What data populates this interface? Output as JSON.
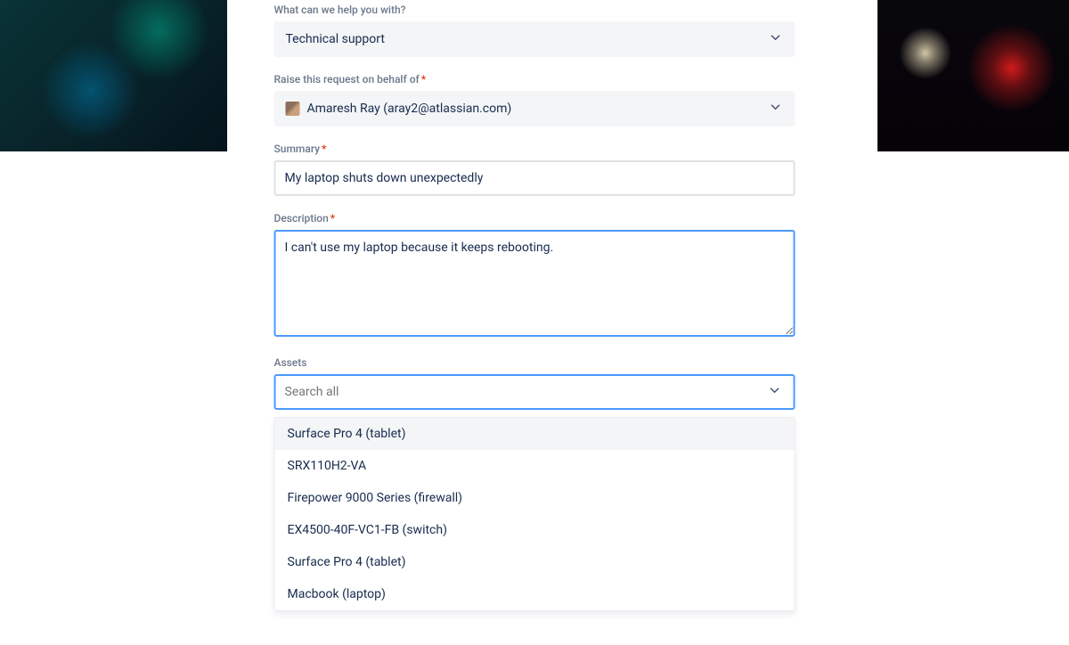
{
  "fields": {
    "help": {
      "label": "What can we help you with?",
      "value": "Technical support"
    },
    "behalf": {
      "label": "Raise this request on behalf of",
      "value": "Amaresh Ray (aray2@atlassian.com)"
    },
    "summary": {
      "label": "Summary",
      "value": "My laptop shuts down unexpectedly"
    },
    "description": {
      "label": "Description",
      "value": "I can't use my laptop because it keeps rebooting."
    },
    "assets": {
      "label": "Assets",
      "placeholder": "Search all",
      "options": [
        "Surface Pro 4 (tablet)",
        "SRX110H2-VA",
        "Firepower 9000 Series (firewall)",
        "EX4500-40F-VC1-FB (switch)",
        "Surface Pro 4 (tablet)",
        "Macbook (laptop)"
      ]
    }
  },
  "required_marker": "*"
}
